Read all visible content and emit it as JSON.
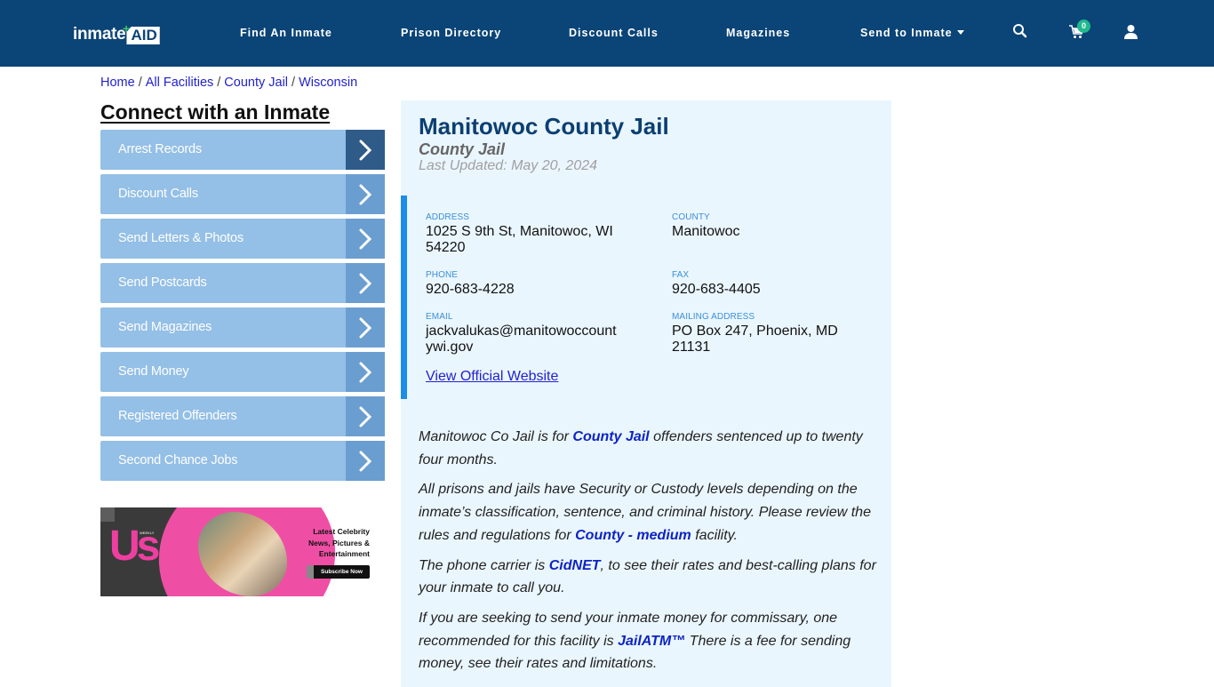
{
  "header": {
    "logo_text": "inmate",
    "logo_box_text": "AID",
    "logo_plus": "+",
    "nav": [
      {
        "label": "Find An Inmate"
      },
      {
        "label": "Prison Directory"
      },
      {
        "label": "Discount Calls"
      },
      {
        "label": "Magazines"
      },
      {
        "label": "Send to Inmate",
        "has_dropdown": true
      }
    ],
    "icons": [
      "search-icon",
      "cart-icon",
      "user-icon"
    ],
    "cart_count": "0",
    "colors": {
      "bar": "#0b4476",
      "badge": "#21b88d"
    }
  },
  "breadcrumb": {
    "items": [
      "Home",
      "All Facilities",
      "County Jail",
      "Wisconsin"
    ],
    "separator": "/"
  },
  "sidebar": {
    "title": "Connect with an Inmate",
    "items": [
      {
        "label": "Arrest Records"
      },
      {
        "label": "Discount Calls"
      },
      {
        "label": "Send Letters & Photos"
      },
      {
        "label": "Send Postcards"
      },
      {
        "label": "Send Magazines"
      },
      {
        "label": "Send Money"
      },
      {
        "label": "Registered Offenders"
      },
      {
        "label": "Second Chance Jobs"
      }
    ],
    "ad": {
      "brand": "Us",
      "brand_sub": "WEEKLY",
      "line1": "Latest Celebrity",
      "line2": "News, Pictures &",
      "line3": "Entertainment",
      "cta": "Subscribe Now"
    }
  },
  "facility": {
    "name": "Manitowoc County Jail",
    "type": "County Jail",
    "last_updated": "Last Updated: May 20, 2024",
    "fields": {
      "address": {
        "label": "ADDRESS",
        "value": "1025 S 9th St, Manitowoc, WI 54220"
      },
      "county": {
        "label": "COUNTY",
        "value": "Manitowoc"
      },
      "phone": {
        "label": "PHONE",
        "value": "920-683-4228"
      },
      "fax": {
        "label": "FAX",
        "value": "920-683-4405"
      },
      "email": {
        "label": "EMAIL",
        "value": "jackvalukas@manitowoccountywi.gov"
      },
      "mailing": {
        "label": "MAILING ADDRESS",
        "value": "PO Box 247, Phoenix, MD 21131"
      }
    },
    "website_link": "View Official Website"
  },
  "description": {
    "p1": {
      "before": "Manitowoc Co Jail is for ",
      "link": "County Jail",
      "after": " offenders sentenced up to twenty four months."
    },
    "p2": {
      "before": "All prisons and jails have Security or Custody levels depending on the inmate’s classification, sentence, and criminal history. Please review the rules and regulations for ",
      "link": "County - medium",
      "after": " facility."
    },
    "p3": {
      "before": "The phone carrier is ",
      "link": "CidNET",
      "after": ", to see their rates and best-calling plans for your inmate to call you."
    },
    "p4": {
      "before": "If you are seeking to send your inmate money for commissary, one recommended for this facility is ",
      "link": "JailATM™",
      "after": " There is a fee for sending money, see their rates and limitations."
    }
  }
}
